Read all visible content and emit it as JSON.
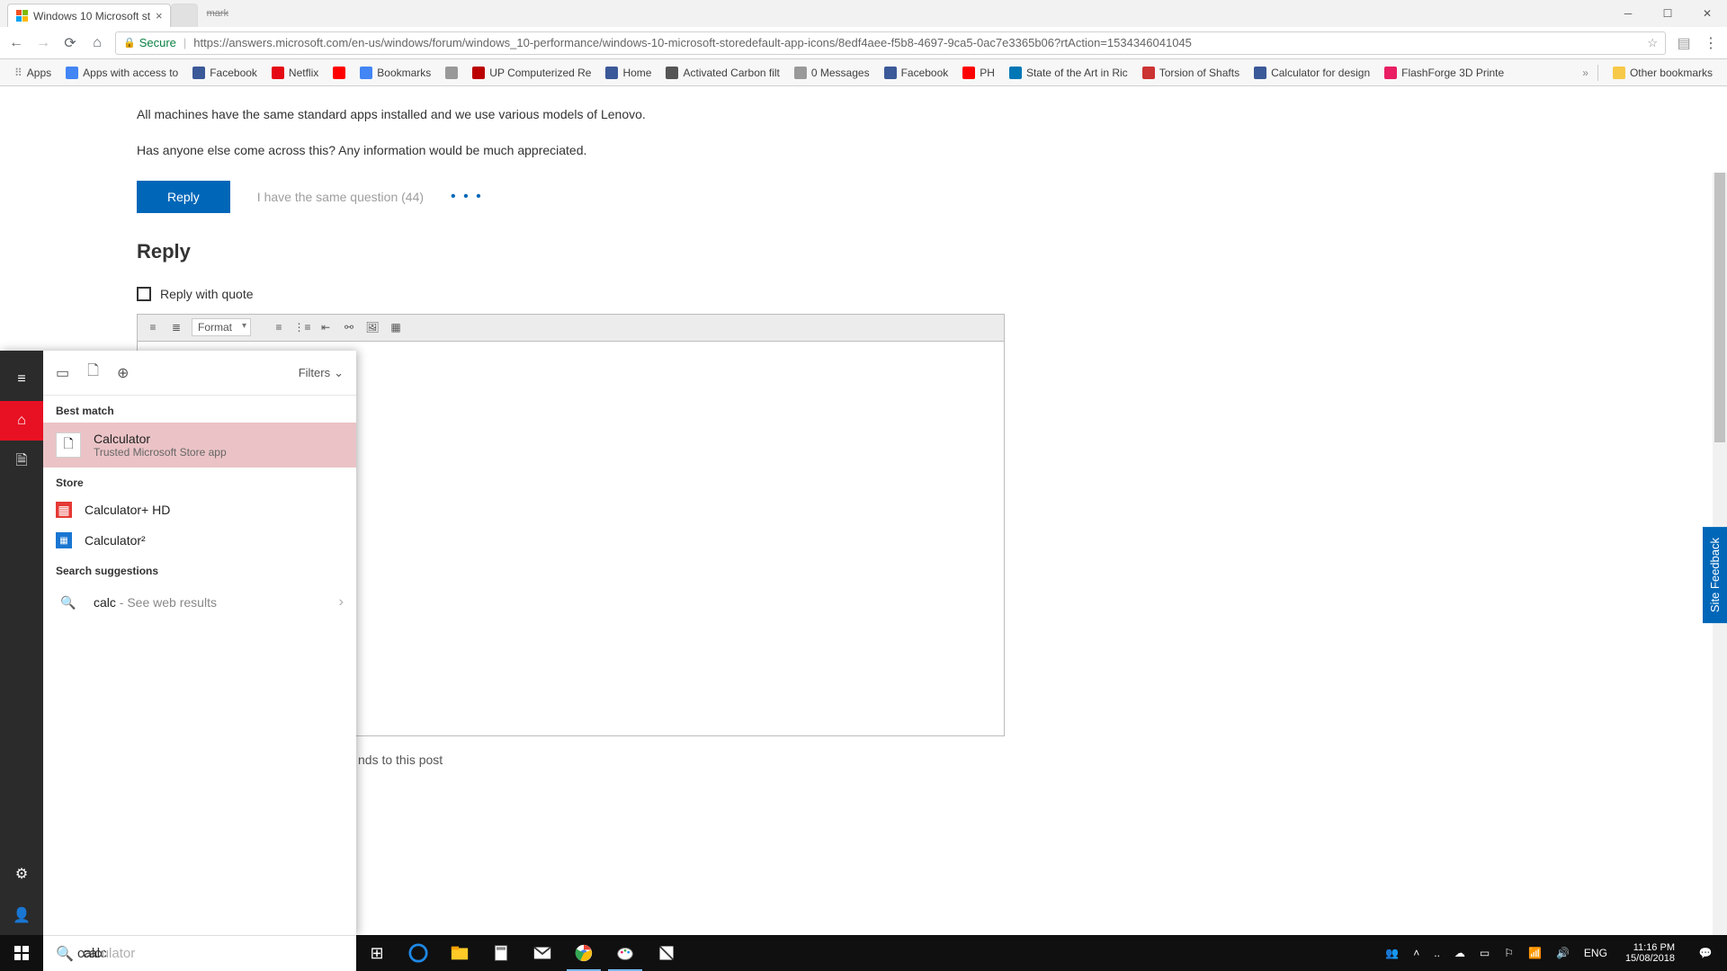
{
  "browser": {
    "tab_title": "Windows 10 Microsoft st",
    "user_badge": "mark",
    "secure_label": "Secure",
    "url": "https://answers.microsoft.com/en-us/windows/forum/windows_10-performance/windows-10-microsoft-storedefault-app-icons/8edf4aee-f5b8-4697-9ca5-0ac7e3365b06?rtAction=1534346041045",
    "bookmarks": [
      {
        "label": "Apps",
        "color": "#888"
      },
      {
        "label": "Apps with access to",
        "color": "#4285f4"
      },
      {
        "label": "Facebook",
        "color": "#3b5998"
      },
      {
        "label": "Netflix",
        "color": "#e50914"
      },
      {
        "label": "",
        "color": "#ff0000"
      },
      {
        "label": "Bookmarks",
        "color": "#4285f4"
      },
      {
        "label": "",
        "color": "#999"
      },
      {
        "label": "UP Computerized Re",
        "color": "#b00"
      },
      {
        "label": "Home",
        "color": "#3b5998"
      },
      {
        "label": "Activated Carbon filt",
        "color": "#555"
      },
      {
        "label": "0 Messages",
        "color": "#999"
      },
      {
        "label": "Facebook",
        "color": "#3b5998"
      },
      {
        "label": "PH",
        "color": "#ff0000"
      },
      {
        "label": "State of the Art in Ric",
        "color": "#0077b5"
      },
      {
        "label": "Torsion of Shafts",
        "color": "#c33"
      },
      {
        "label": "Calculator for design",
        "color": "#3b5998"
      },
      {
        "label": "FlashForge 3D Printe",
        "color": "#e91e63"
      }
    ],
    "overflow_label": "»",
    "other_bookmarks": "Other bookmarks"
  },
  "page": {
    "para1": "All machines have the same standard apps installed and we use various models of Lenovo.",
    "para2": "Has anyone else come across this? Any information would be much appreciated.",
    "reply_btn": "Reply",
    "same_question": "I have the same question (44)",
    "reply_heading": "Reply",
    "reply_quote": "Reply with quote",
    "format_label": "Format",
    "truncated": "nds to this post",
    "feedback": "Site Feedback"
  },
  "start": {
    "filters": "Filters",
    "best_match": "Best match",
    "best": {
      "title": "Calculator",
      "sub": "Trusted Microsoft Store app"
    },
    "store_label": "Store",
    "store1": "Calculator+ HD",
    "store2": "Calculator²",
    "suggestions_label": "Search suggestions",
    "suggest_term": "calc",
    "suggest_tail": " - See web results",
    "typed": "calc",
    "completion": "ulator"
  },
  "tray": {
    "lang": "ENG",
    "time": "11:16 PM",
    "date": "15/08/2018"
  }
}
